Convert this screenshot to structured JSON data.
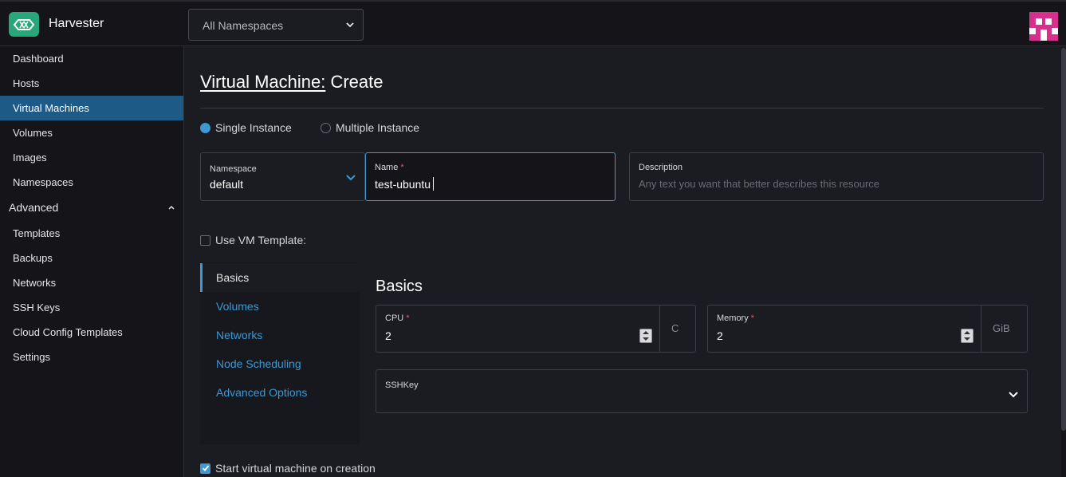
{
  "header": {
    "app_title": "Harvester",
    "namespace_selector": "All Namespaces",
    "logo_icon": "harvester-logo-icon",
    "brand_color": "#2aa77a",
    "avatar_color": "#d6308a"
  },
  "sidebar": {
    "items": [
      {
        "label": "Dashboard"
      },
      {
        "label": "Hosts"
      },
      {
        "label": "Virtual Machines",
        "active": true
      },
      {
        "label": "Volumes"
      },
      {
        "label": "Images"
      },
      {
        "label": "Namespaces"
      }
    ],
    "group_label": "Advanced",
    "group_items": [
      {
        "label": "Templates"
      },
      {
        "label": "Backups"
      },
      {
        "label": "Networks"
      },
      {
        "label": "SSH Keys"
      },
      {
        "label": "Cloud Config Templates"
      },
      {
        "label": "Settings"
      }
    ]
  },
  "page": {
    "title_crumb": "Virtual Machine:",
    "title_action": " Create"
  },
  "instance_mode": {
    "single_label": "Single Instance",
    "multiple_label": "Multiple Instance",
    "selected": "single"
  },
  "form": {
    "namespace": {
      "label": "Namespace",
      "value": "default"
    },
    "name": {
      "label": "Name",
      "required_mark": "*",
      "value": "test-ubuntu"
    },
    "description": {
      "label": "Description",
      "placeholder": "Any text you want that better describes this resource"
    },
    "use_template_label": "Use VM Template:",
    "start_on_creation_label": "Start virtual machine on creation",
    "start_on_creation_checked": true
  },
  "tabs": [
    {
      "label": "Basics",
      "active": true
    },
    {
      "label": "Volumes"
    },
    {
      "label": "Networks"
    },
    {
      "label": "Node Scheduling"
    },
    {
      "label": "Advanced Options"
    }
  ],
  "basics": {
    "section_title": "Basics",
    "cpu": {
      "label": "CPU",
      "required_mark": "*",
      "value": "2",
      "unit": "C"
    },
    "memory": {
      "label": "Memory",
      "required_mark": "*",
      "value": "2",
      "unit": "GiB"
    },
    "sshkey": {
      "label": "SSHKey"
    }
  },
  "colors": {
    "accent": "#3d98d3",
    "active_nav": "#1e5a86",
    "required": "#e05a5a"
  }
}
